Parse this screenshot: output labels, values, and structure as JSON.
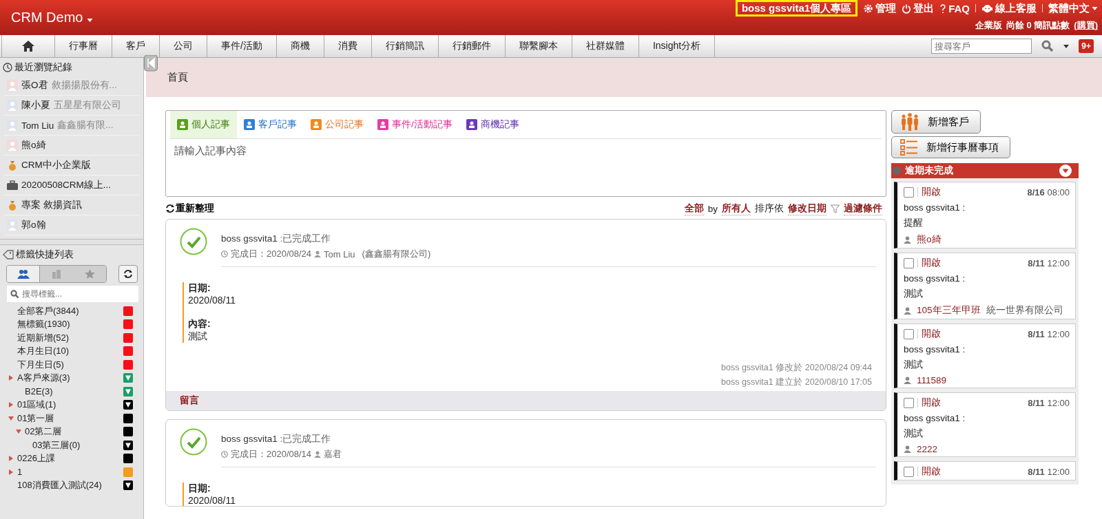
{
  "app": {
    "title": "CRM Demo"
  },
  "user_menu": {
    "profile_link": "boss gssvita1個人專區",
    "items": [
      {
        "kind": "gear",
        "label": "管理"
      },
      {
        "kind": "power",
        "label": "登出"
      },
      {
        "kind": "help",
        "label": "FAQ"
      },
      {
        "kind": "chat",
        "label": "線上客服"
      }
    ],
    "language": "繁體中文"
  },
  "account_info": {
    "edition": "企業版",
    "sms_text": "尚餘 0 簡訊點數",
    "buy_link": "(購買)"
  },
  "nav": {
    "tabs": [
      {
        "kind": "home"
      },
      {
        "kind": "text",
        "label": "行事曆"
      },
      {
        "kind": "text",
        "label": "客戶"
      },
      {
        "kind": "text",
        "label": "公司"
      },
      {
        "kind": "text",
        "label": "事件/活動"
      },
      {
        "kind": "text",
        "label": "商機"
      },
      {
        "kind": "text",
        "label": "消費"
      },
      {
        "kind": "text",
        "label": "行銷簡訊"
      },
      {
        "kind": "text",
        "label": "行銷郵件"
      },
      {
        "kind": "text",
        "label": "聯繫腳本"
      },
      {
        "kind": "text",
        "label": "社群媒體"
      },
      {
        "kind": "text",
        "label": "Insight分析"
      }
    ],
    "search": {
      "placeholder": "搜尋客戶"
    },
    "notification_badge": "9+"
  },
  "sidebar": {
    "recent": {
      "title": "最近瀏覽紀錄",
      "items": [
        {
          "kind": "female",
          "name": "張O君",
          "company": "敘揚揚股份有..."
        },
        {
          "kind": "male",
          "name": "陳小夏",
          "company": "五星星有限公司"
        },
        {
          "kind": "male",
          "name": "Tom Liu",
          "company": "鑫鑫腸有限..."
        },
        {
          "kind": "female",
          "name": "熊o綺"
        },
        {
          "kind": "deal",
          "name": "CRM中小企業版"
        },
        {
          "kind": "project",
          "name": "20200508CRM線上..."
        },
        {
          "kind": "deal",
          "name": "專案 敘揚資訊"
        },
        {
          "kind": "male",
          "name": "郭o翰"
        }
      ]
    },
    "tags": {
      "title": "標籤快捷列表",
      "filter_tabs": [
        {
          "kind": "people",
          "selected": true
        },
        {
          "kind": "company",
          "selected": false
        },
        {
          "kind": "star",
          "selected": false
        }
      ],
      "search": {
        "placeholder": "搜尋標籤..."
      },
      "items": [
        {
          "kind": "square",
          "label": "全部客戶(3844)",
          "color": "#f5101a"
        },
        {
          "kind": "square",
          "label": "無標籤(1930)",
          "color": "#f5101a"
        },
        {
          "kind": "square",
          "label": "近期新增(52)",
          "color": "#f5101a"
        },
        {
          "kind": "square",
          "label": "本月生日(10)",
          "color": "#f5101a"
        },
        {
          "kind": "square",
          "label": "下月生日(5)",
          "color": "#f5101a"
        },
        {
          "kind": "filter",
          "expanded": false,
          "label": "A客戶來源(3)",
          "color": "#1a9e6a",
          "children": [
            {
              "kind": "filter",
              "label": "B2E(3)",
              "color": "#1a9e6a"
            }
          ]
        },
        {
          "kind": "filter",
          "expanded": false,
          "label": "01區域(1)",
          "color": "#000000"
        },
        {
          "kind": "square",
          "expanded": true,
          "label": "01第一層",
          "color": "#000000",
          "children": [
            {
              "kind": "square",
              "expanded": true,
              "label": "02第二層",
              "color": "#000000",
              "children": [
                {
                  "kind": "filter",
                  "label": "03第三層(0)",
                  "color": "#000000"
                }
              ]
            }
          ]
        },
        {
          "kind": "square",
          "expanded": false,
          "label": "0226上課",
          "color": "#000000"
        },
        {
          "kind": "square",
          "expanded": false,
          "label": "1",
          "color": "#f39c1f"
        },
        {
          "kind": "filter",
          "label": "108消費匯入測試(24)",
          "color": "#000000"
        }
      ]
    }
  },
  "page": {
    "title": "首頁"
  },
  "composer": {
    "tabs": [
      {
        "kind": "personal",
        "label": "個人記事",
        "selected": true
      },
      {
        "kind": "customer",
        "label": "客戶記事",
        "selected": false
      },
      {
        "kind": "company",
        "label": "公司記事",
        "selected": false
      },
      {
        "kind": "event",
        "label": "事件/活動記事",
        "selected": false
      },
      {
        "kind": "deal",
        "label": "商機記事",
        "selected": false
      }
    ],
    "placeholder": "請輸入記事內容"
  },
  "feed_toolbar": {
    "refresh": "重新整理",
    "scope": "全部",
    "by": "by",
    "owner": "所有人",
    "sort_prefix": "排序依",
    "sort_field": "修改日期",
    "filter": "過濾條件"
  },
  "posts": [
    {
      "author": "boss gssvita1",
      "action": ":已完成工作",
      "completed": "完成日：2020/08/24",
      "contact": "Tom Liu",
      "company": "(鑫鑫腸有限公司)",
      "fields": [
        {
          "label": "日期:",
          "value": "2020/08/11"
        },
        {
          "label": "內容:",
          "value": "測試"
        }
      ],
      "modified": "boss gssvita1 修改於 2020/08/24 09:44",
      "created": "boss gssvita1 建立於 2020/08/10 17:05",
      "comment_link": "留言"
    },
    {
      "author": "boss gssvita1",
      "action": ":已完成工作",
      "completed": "完成日：2020/08/14",
      "contact": "嘉君",
      "fields": [
        {
          "label": "日期:",
          "value": "2020/08/11"
        }
      ]
    }
  ],
  "actions": [
    {
      "kind": "customer",
      "label": "新增客戶"
    },
    {
      "kind": "calendar",
      "label": "新增行事曆事項"
    }
  ],
  "overdue": {
    "title": "逾期未完成",
    "tasks": [
      {
        "checked": false,
        "status": "開啟",
        "date": "8/16",
        "time": "08:00",
        "author": "boss gssvita1 :",
        "content": "提醒",
        "contact": "熊o綺"
      },
      {
        "checked": false,
        "status": "開啟",
        "date": "8/11",
        "time": "12:00",
        "author": "boss gssvita1 :",
        "content": "測試",
        "contact": "105年三年甲班",
        "company": "統一世界有限公司"
      },
      {
        "checked": false,
        "status": "開啟",
        "date": "8/11",
        "time": "12:00",
        "author": "boss gssvita1 :",
        "content": "測試",
        "contact": "111589"
      },
      {
        "checked": false,
        "status": "開啟",
        "date": "8/11",
        "time": "12:00",
        "author": "boss gssvita1 :",
        "content": "測試",
        "contact": "2222"
      },
      {
        "checked": false,
        "status": "開啟",
        "date": "8/11",
        "time": "12:00"
      }
    ]
  }
}
